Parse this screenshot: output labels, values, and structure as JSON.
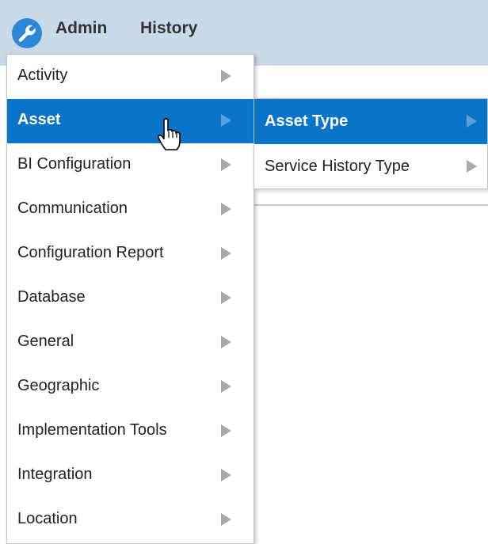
{
  "topbar": {
    "logo_icon": "wrench-icon",
    "admin_label": "Admin",
    "history_label": "History",
    "bar_color": "#c8d9e8"
  },
  "menu": {
    "items": [
      {
        "label": "Activity",
        "active": false
      },
      {
        "label": "Asset",
        "active": true
      },
      {
        "label": "BI Configuration",
        "active": false
      },
      {
        "label": "Communication",
        "active": false
      },
      {
        "label": "Configuration Report",
        "active": false
      },
      {
        "label": "Database",
        "active": false
      },
      {
        "label": "General",
        "active": false
      },
      {
        "label": "Geographic",
        "active": false
      },
      {
        "label": "Implementation Tools",
        "active": false
      },
      {
        "label": "Integration",
        "active": false
      },
      {
        "label": "Location",
        "active": false
      }
    ],
    "highlight_color": "#0a74c9"
  },
  "submenu": {
    "items": [
      {
        "label": "Asset Type",
        "active": true
      },
      {
        "label": "Service History Type",
        "active": false
      }
    ]
  },
  "cursor_icon": "hand-pointer-icon"
}
